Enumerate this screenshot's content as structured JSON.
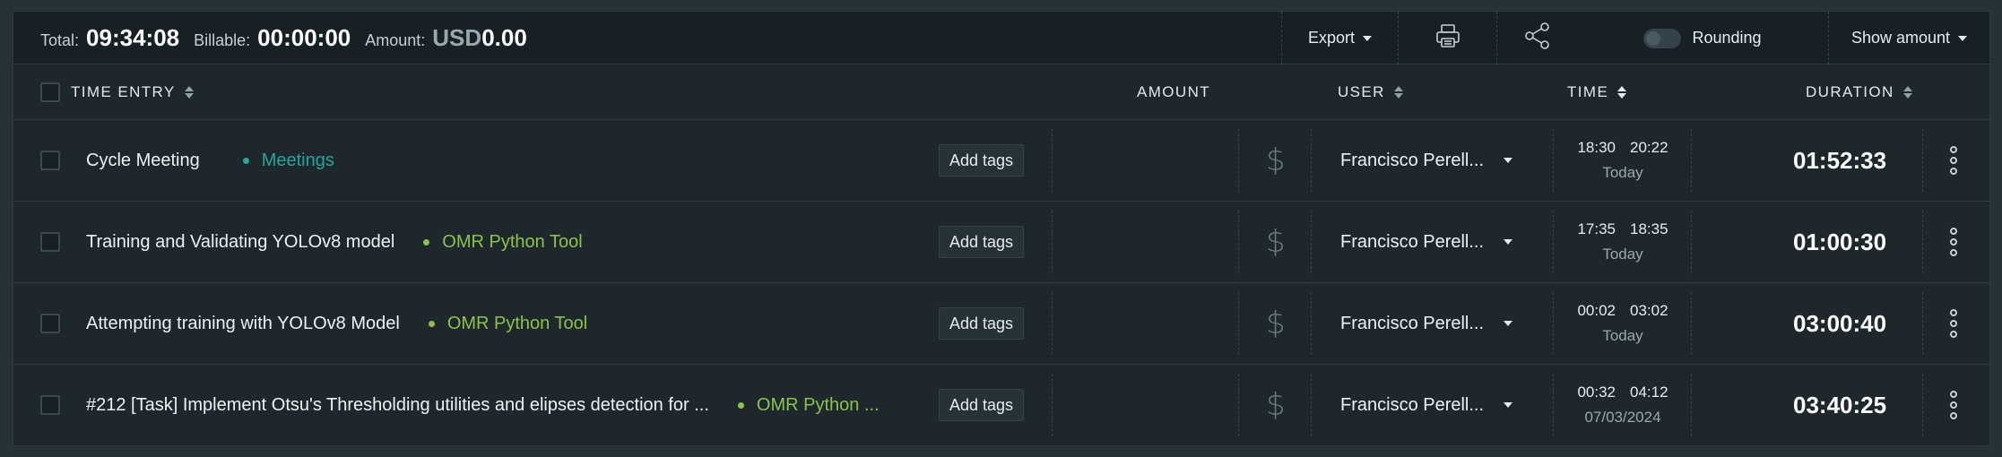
{
  "summary": {
    "total_label": "Total:",
    "total_value": "09:34:08",
    "billable_label": "Billable:",
    "billable_value": "00:00:00",
    "amount_label": "Amount:",
    "amount_currency": "USD",
    "amount_value": "0.00"
  },
  "toolbar": {
    "export_label": "Export",
    "print_icon": "printer-icon",
    "share_icon": "share-icon",
    "rounding_label": "Rounding",
    "rounding_on": false,
    "show_amount_label": "Show amount"
  },
  "columns": {
    "time_entry": "TIME ENTRY",
    "amount": "AMOUNT",
    "user": "USER",
    "time": "TIME",
    "duration": "DURATION"
  },
  "colors": {
    "meetings": "#26a69a",
    "omr_python_tool": "#8bc34a",
    "background": "#1e272c",
    "summary_bar": "#172024"
  },
  "entries": [
    {
      "description": "Cycle Meeting",
      "project": "Meetings",
      "project_color": "#26a69a",
      "tags_label": "Add tags",
      "user": "Francisco Perell...",
      "start": "18:30",
      "end": "20:22",
      "date": "Today",
      "duration": "01:52:33"
    },
    {
      "description": "Training and Validating YOLOv8 model",
      "project": "OMR Python Tool",
      "project_color": "#8bc34a",
      "tags_label": "Add tags",
      "user": "Francisco Perell...",
      "start": "17:35",
      "end": "18:35",
      "date": "Today",
      "duration": "01:00:30"
    },
    {
      "description": "Attempting training with YOLOv8 Model",
      "project": "OMR Python Tool",
      "project_color": "#8bc34a",
      "tags_label": "Add tags",
      "user": "Francisco Perell...",
      "start": "00:02",
      "end": "03:02",
      "date": "Today",
      "duration": "03:00:40"
    },
    {
      "description": "#212 [Task] Implement Otsu's Thresholding utilities and elipses detection for ...",
      "project": "OMR Python ...",
      "project_color": "#8bc34a",
      "tags_label": "Add tags",
      "user": "Francisco Perell...",
      "start": "00:32",
      "end": "04:12",
      "date": "07/03/2024",
      "duration": "03:40:25"
    }
  ]
}
